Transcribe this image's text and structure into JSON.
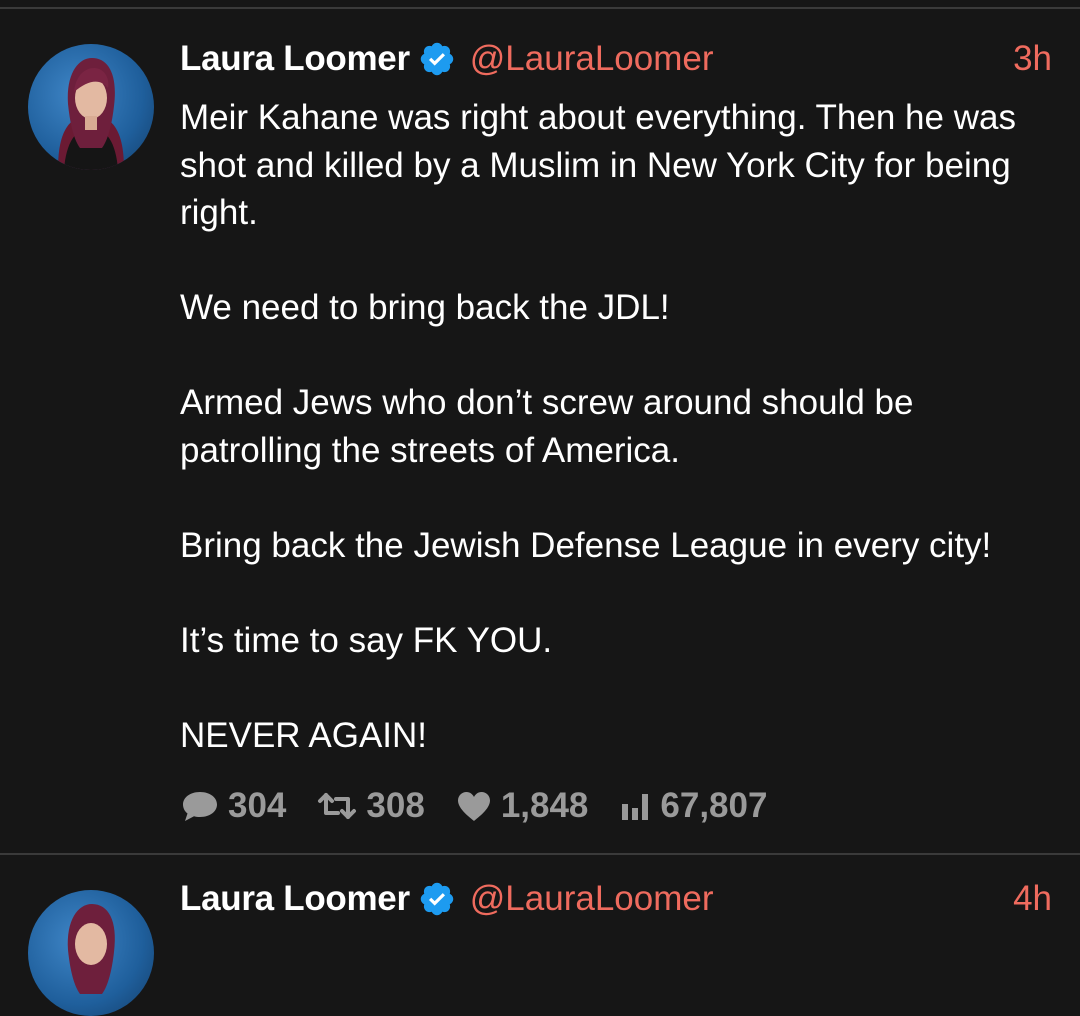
{
  "tweets": [
    {
      "author": "Laura Loomer",
      "handle": "@LauraLoomer",
      "time": "3h",
      "paragraphs": [
        "Meir Kahane was right about everything. Then he was shot and killed by a Muslim in New York City for being right.",
        "We need to bring back the JDL!",
        "Armed Jews who don’t screw around should be patrolling the streets of America.",
        "Bring back the Jewish Defense League in every city!",
        "It’s time to say FK YOU.",
        "NEVER AGAIN!"
      ],
      "stats": {
        "replies": "304",
        "retweets": "308",
        "likes": "1,848",
        "views": "67,807"
      }
    },
    {
      "author": "Laura Loomer",
      "handle": "@LauraLoomer",
      "time": "4h"
    }
  ],
  "icons": {
    "verified": "verified-badge-icon",
    "reply": "speech-bubble-icon",
    "retweet": "retweet-arrows-icon",
    "like": "heart-icon",
    "views": "bar-chart-icon"
  },
  "colors": {
    "background": "#161616",
    "accent": "#ef6b5e",
    "verified": "#1d9bf0",
    "muted": "#9a9a9a"
  }
}
